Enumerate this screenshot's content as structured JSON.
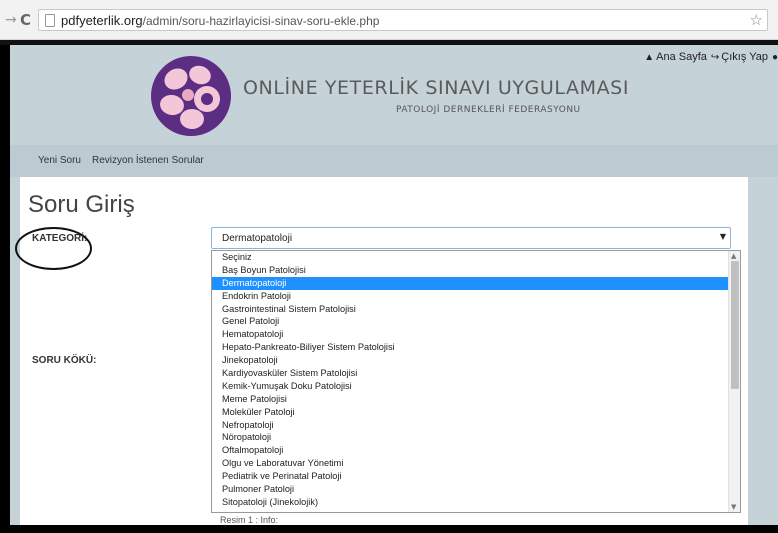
{
  "browser": {
    "url_host": "pdfyeterlik.org",
    "url_path": "/admin/soru-hazirlayicisi-sinav-soru-ekle.php"
  },
  "topnav": {
    "home": "Ana Sayfa",
    "logout": "Çıkış Yap"
  },
  "site": {
    "title": "ONLİNE YETERLİK SINAVI UYGULAMASI",
    "subtitle": "PATOLOJİ DERNEKLERİ FEDERASYONU"
  },
  "menu": {
    "items": [
      "Yeni Soru",
      "Revizyon İstenen Sorular"
    ]
  },
  "form": {
    "page_title": "Soru Giriş",
    "category_label": "KATEGORİ:",
    "stem_label": "SORU KÖKÜ:",
    "selected_value": "Dermatopatoloji",
    "hidden_caption": "Resim 1 : Info:"
  },
  "dropdown": {
    "options": [
      "Seçiniz",
      "Baş Boyun Patolojisi",
      "Dermatopatoloji",
      "Endokrin Patoloji",
      "Gastrointestinal Sistem Patolojisi",
      "Genel Patoloji",
      "Hematopatoloji",
      "Hepato-Pankreato-Biliyer Sistem Patolojisi",
      "Jinekopatoloji",
      "Kardiyovasküler Sistem Patolojisi",
      "Kemik-Yumuşak Doku Patolojisi",
      "Meme Patolojisi",
      "Moleküler Patoloji",
      "Nefropatoloji",
      "Nöropatoloji",
      "Oftalmopatoloji",
      "Olgu ve Laboratuvar Yönetimi",
      "Pediatrik ve Perinatal Patoloji",
      "Pulmoner Patoloji",
      "Sitopatoloji (Jinekolojik)"
    ],
    "selected_index": 2
  },
  "colors": {
    "header_bg": "#c5d2d8",
    "selected_bg": "#1e90ff",
    "logo_purple": "#5b2d83",
    "logo_pink": "#f3c6d8"
  }
}
